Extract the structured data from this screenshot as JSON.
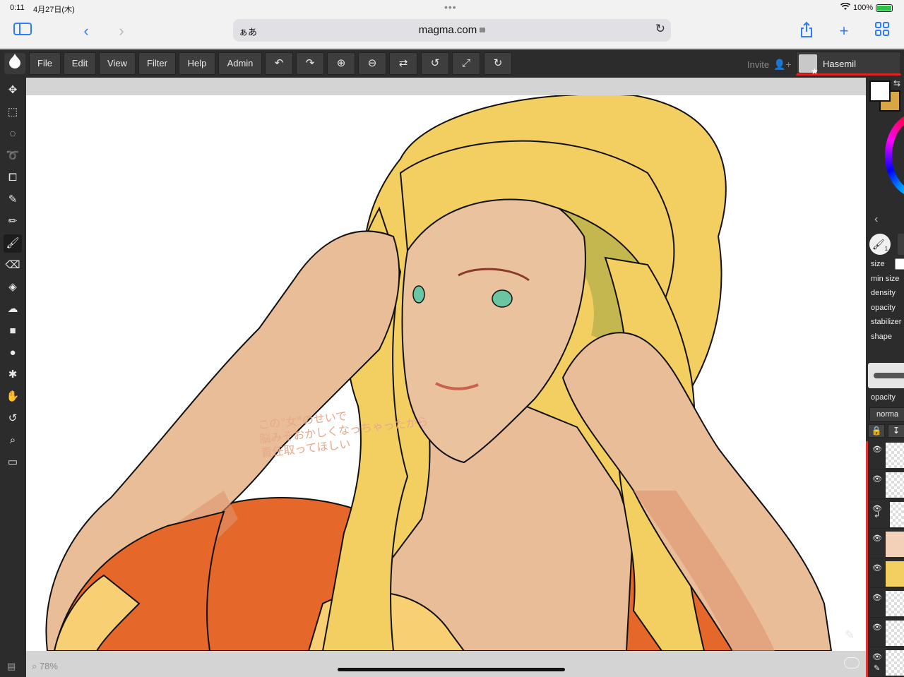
{
  "status_bar": {
    "time": "0:11",
    "date": "4月27日(木)",
    "battery_pct": "100%"
  },
  "safari": {
    "aa_label": "ぁあ",
    "url": "magma.com"
  },
  "app": {
    "menus": [
      "File",
      "Edit",
      "View",
      "Filter",
      "Help",
      "Admin"
    ],
    "invite_label": "Invite",
    "user_name": "Hasemil"
  },
  "canvas": {
    "note_lines": [
      "この\"女\"のせいで",
      "脳みそおかしくなっちゃったから",
      "責任取ってほしい"
    ],
    "zoom": "78%"
  },
  "brush_panel": {
    "labels": [
      "size",
      "min size",
      "density",
      "opacity",
      "stabilizer",
      "shape"
    ],
    "layer_opacity_label": "opacity",
    "blend_mode": "norma",
    "brush_badge": "1"
  },
  "colors": {
    "primary": "#ffffff",
    "secondary": "#d8a642",
    "accent": "#2f7df6",
    "user_underline": "#dd2222"
  }
}
